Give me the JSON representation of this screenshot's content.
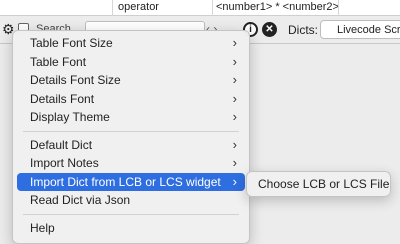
{
  "background_row": {
    "cell_operator": "operator",
    "cell_expression": "<number1> * <number2>"
  },
  "toolbar": {
    "search_label": "Search",
    "dicts_label": "Dicts:",
    "dicts_value": "Livecode Script"
  },
  "menu": {
    "items": [
      {
        "label": "Table Font Size",
        "has_submenu": true
      },
      {
        "label": "Table Font",
        "has_submenu": true
      },
      {
        "label": "Details Font Size",
        "has_submenu": true
      },
      {
        "label": "Details Font",
        "has_submenu": true
      },
      {
        "label": "Display Theme",
        "has_submenu": true
      },
      {
        "label": "Default Dict",
        "has_submenu": true
      },
      {
        "label": "Import Notes",
        "has_submenu": true
      },
      {
        "label": "Import Dict from LCB or LCS widget",
        "has_submenu": true,
        "highlighted": true
      },
      {
        "label": "Read Dict via Json",
        "has_submenu": false
      },
      {
        "label": "Help",
        "has_submenu": false
      }
    ]
  },
  "submenu": {
    "items": [
      {
        "label": "Choose LCB or LCS File"
      }
    ]
  },
  "colors": {
    "highlight": "#2f6ee0"
  }
}
